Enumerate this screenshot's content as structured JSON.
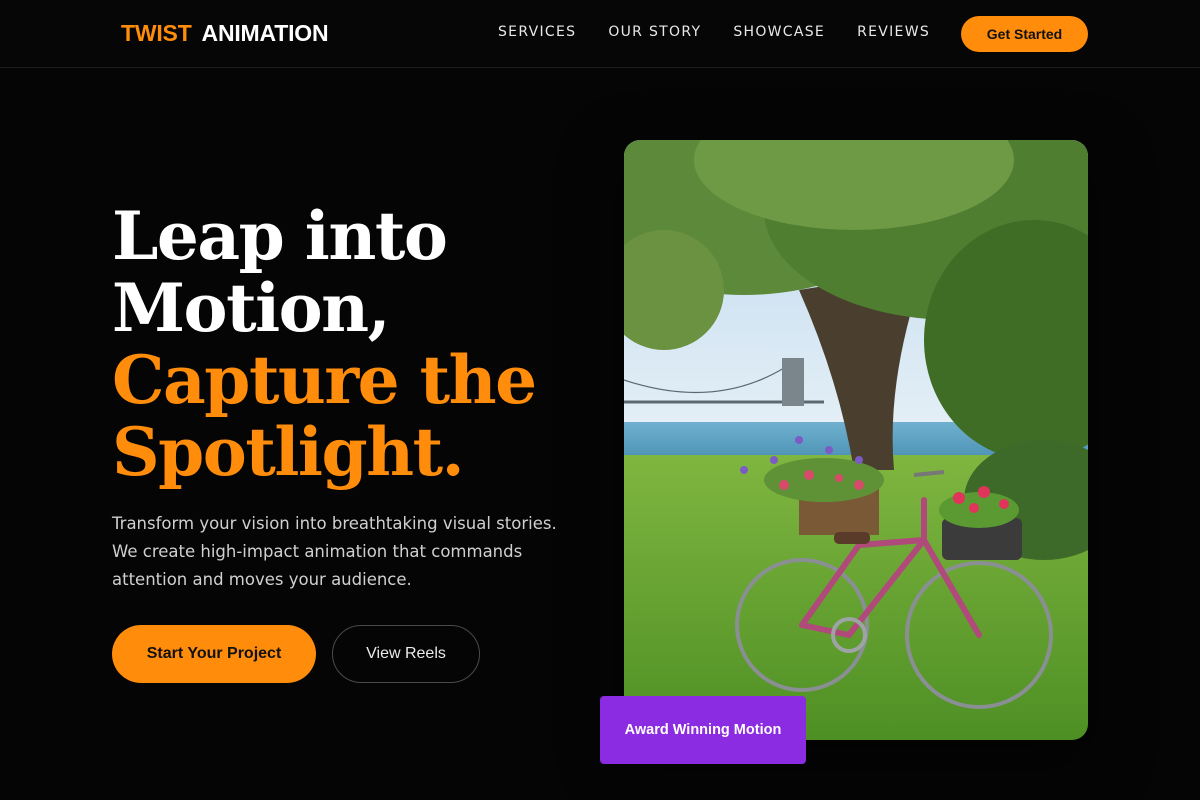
{
  "brand": {
    "accent_word": "TWIST",
    "rest_word": "ANIMATION"
  },
  "nav": {
    "items": [
      "SERVICES",
      "OUR STORY",
      "SHOWCASE",
      "REVIEWS"
    ],
    "cta": "Get Started"
  },
  "hero": {
    "headline_white_1": "Leap into",
    "headline_white_2": "Motion,",
    "headline_orange_1": "Capture the",
    "headline_orange_2": "Spotlight.",
    "subtitle_1": "Transform your vision into breathtaking visual stories.",
    "subtitle_2": "We create high-impact animation that commands",
    "subtitle_3": "attention and moves your audience.",
    "primary_button": "Start Your Project",
    "secondary_button": "View Reels"
  },
  "badge": {
    "label": "Award Winning Motion"
  },
  "colors": {
    "accent": "#ff8c0a",
    "badge": "#8b2be2",
    "background": "#050505"
  },
  "image": {
    "subject": "bicycle-with-flower-baskets-under-tree"
  }
}
